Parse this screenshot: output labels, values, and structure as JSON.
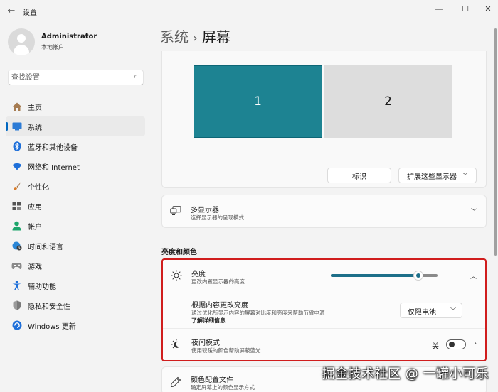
{
  "window": {
    "title": "设置",
    "back_icon": "back-arrow-icon",
    "controls": [
      "minimize-icon",
      "maximize-icon",
      "close-icon"
    ]
  },
  "user": {
    "name": "Administrator",
    "account_type": "本地帐户"
  },
  "search": {
    "placeholder": "查找设置",
    "value": ""
  },
  "sidebar": {
    "items": [
      {
        "label": "主页",
        "icon": "home-icon",
        "active": false
      },
      {
        "label": "系统",
        "icon": "system-display-icon",
        "active": true
      },
      {
        "label": "蓝牙和其他设备",
        "icon": "bluetooth-icon",
        "active": false
      },
      {
        "label": "网络和 Internet",
        "icon": "wifi-icon",
        "active": false
      },
      {
        "label": "个性化",
        "icon": "brush-icon",
        "active": false
      },
      {
        "label": "应用",
        "icon": "apps-icon",
        "active": false
      },
      {
        "label": "帐户",
        "icon": "account-icon",
        "active": false
      },
      {
        "label": "时间和语言",
        "icon": "globe-clock-icon",
        "active": false
      },
      {
        "label": "游戏",
        "icon": "gamepad-icon",
        "active": false
      },
      {
        "label": "辅助功能",
        "icon": "accessibility-icon",
        "active": false
      },
      {
        "label": "隐私和安全性",
        "icon": "shield-icon",
        "active": false
      },
      {
        "label": "Windows 更新",
        "icon": "windows-update-icon",
        "active": false
      }
    ]
  },
  "breadcrumb": {
    "parent": "系统",
    "separator": "›",
    "current": "屏幕"
  },
  "displays": {
    "monitors": [
      "1",
      "2"
    ],
    "selected": "1",
    "identify_label": "标识",
    "extend_label": "扩展这些显示器"
  },
  "multi_display": {
    "title": "多显示器",
    "subtitle": "选择显示器的呈现模式",
    "icon": "multi-display-icon"
  },
  "section": {
    "brightness_color": "亮度和颜色"
  },
  "brightness": {
    "title": "亮度",
    "subtitle": "更改内置显示器的亮度",
    "icon": "sun-icon",
    "value_fraction": 0.82,
    "adaptive": {
      "title": "根据内容更改亮度",
      "subtitle": "通过优化所显示内容的屏幕对比度和亮度来帮助节省电源",
      "link": "了解详细信息",
      "dropdown_value": "仅限电池"
    }
  },
  "night_light": {
    "title": "夜间模式",
    "subtitle": "使用较暖的颜色帮助屏蔽蓝光",
    "icon": "night-light-icon",
    "state_label": "关",
    "on": false
  },
  "color_profile": {
    "title": "颜色配置文件",
    "subtitle": "确定屏幕上的颜色显示方式",
    "icon": "color-pen-icon"
  },
  "watermark": "掘金技术社区 @ 一罐小可乐",
  "colors": {
    "accent": "#0067c0",
    "monitor_selected": "#1d8392",
    "highlight_border": "#d01d1d"
  }
}
